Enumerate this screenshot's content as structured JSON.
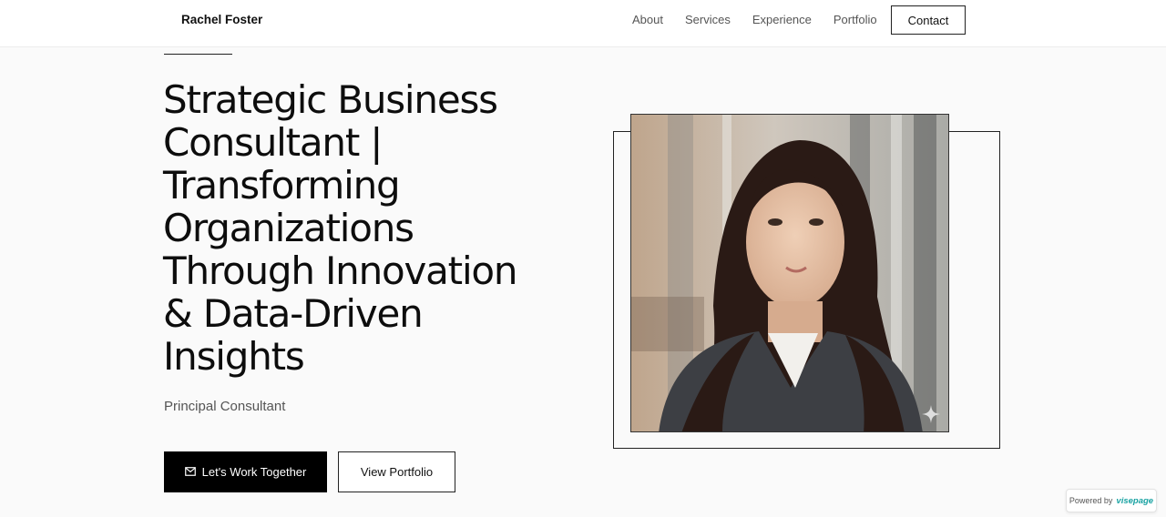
{
  "nav": {
    "brand": "Rachel Foster",
    "links": [
      "About",
      "Services",
      "Experience",
      "Portfolio"
    ],
    "contact_label": "Contact"
  },
  "hero": {
    "title": "Strategic Business Consultant | Transforming Organizations Through Innovation & Data-Driven Insights",
    "subtitle": "Principal Consultant",
    "primary_cta": {
      "icon": "mail-icon",
      "label": "Let's Work Together"
    },
    "secondary_cta": {
      "label": "View Portfolio"
    }
  },
  "portrait": {
    "description_icon": "sparkle-icon"
  },
  "badge": {
    "text": "Powered by",
    "logo": "visepage"
  },
  "colors": {
    "page_background": "#fafafa",
    "primary_button": "#000000",
    "text": "#111111",
    "muted_text": "#555555",
    "badge_logo": "#1aa3a3"
  }
}
